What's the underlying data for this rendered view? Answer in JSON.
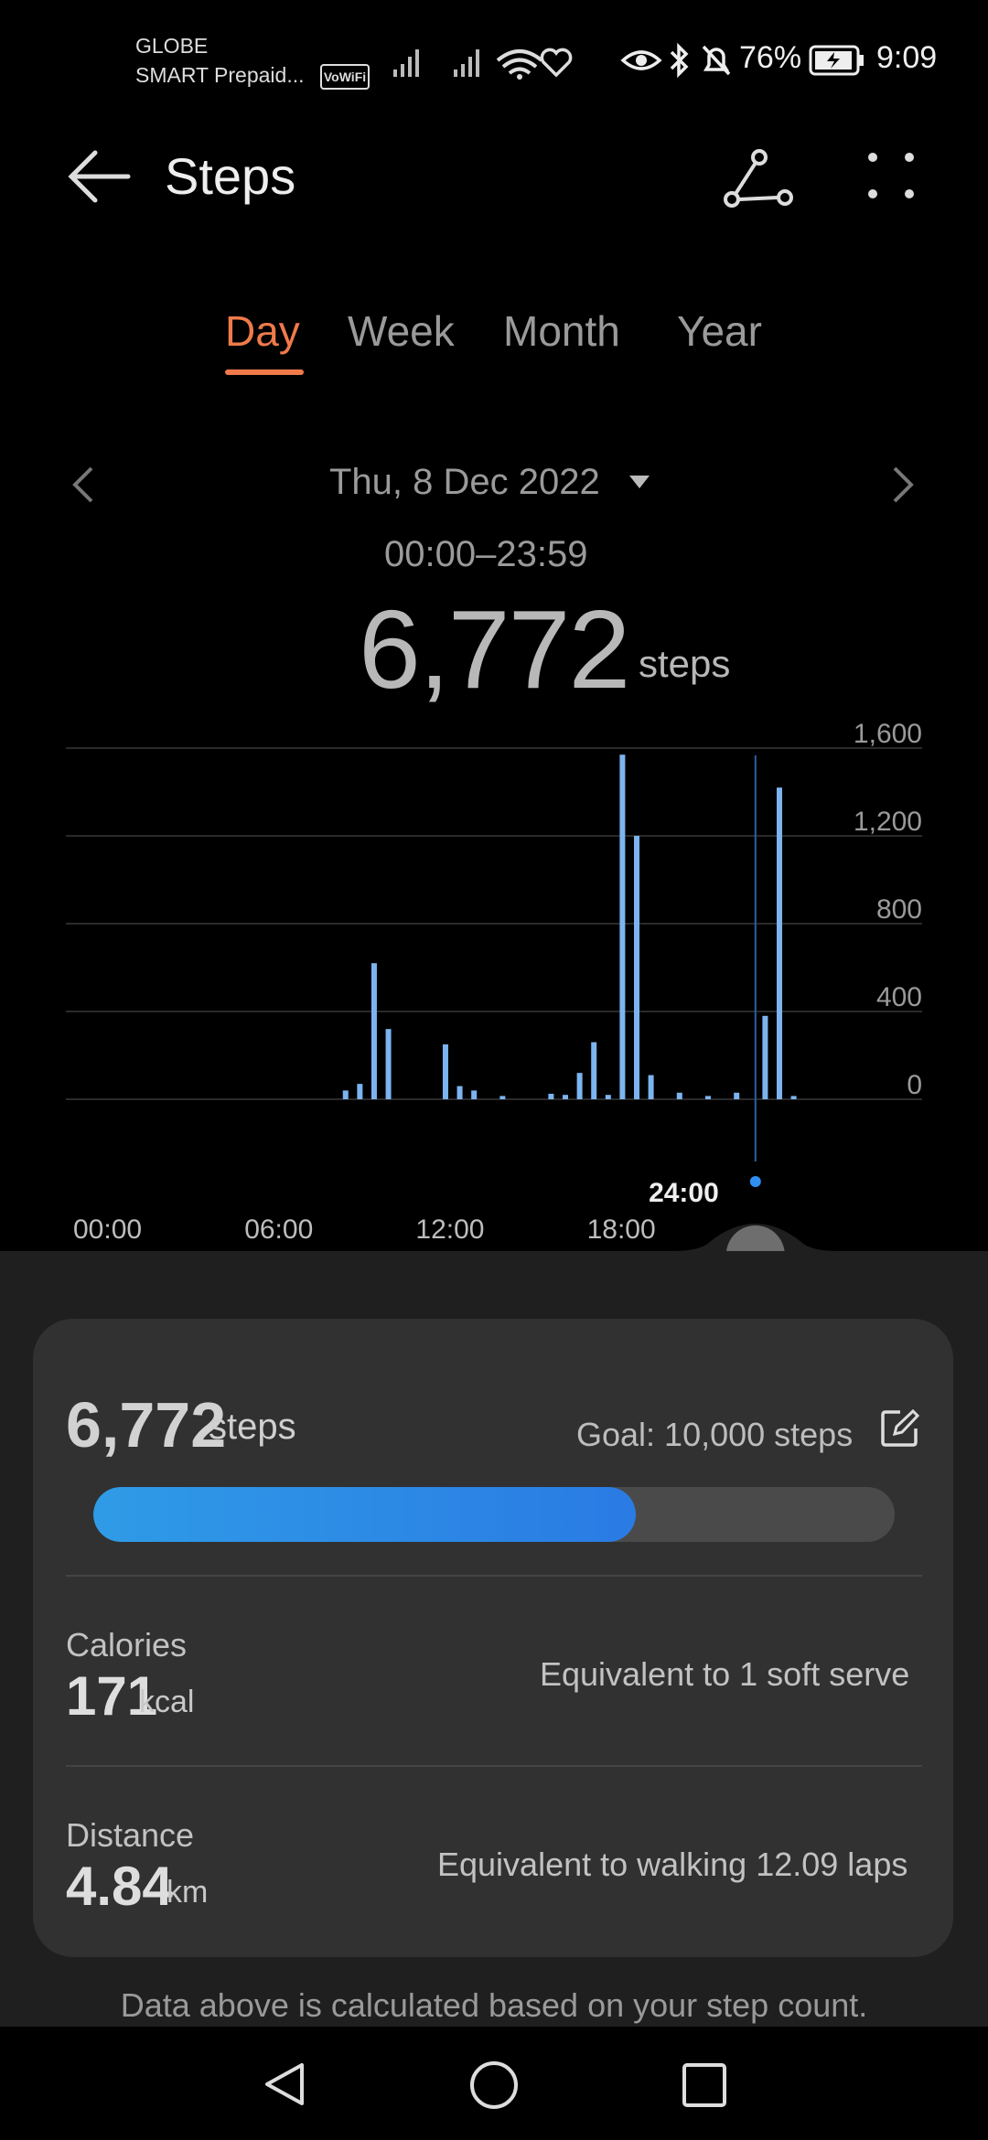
{
  "status_bar": {
    "carrier_line1": "GLOBE",
    "carrier_line2": "SMART Prepaid...",
    "vowifi_label": "VoWiFi",
    "battery_percent": "76%",
    "time": "9:09"
  },
  "header": {
    "title": "Steps",
    "back_icon": "back-arrow-icon",
    "share_icon": "share-route-icon",
    "more_icon": "more-dots-icon"
  },
  "tabs": [
    {
      "label": "Day",
      "active": true
    },
    {
      "label": "Week",
      "active": false
    },
    {
      "label": "Month",
      "active": false
    },
    {
      "label": "Year",
      "active": false
    }
  ],
  "date_nav": {
    "date": "Thu, 8 Dec 2022",
    "range": "00:00–23:59"
  },
  "summary": {
    "steps": "6,772",
    "unit": "steps"
  },
  "chart_data": {
    "type": "bar",
    "y_ticks": [
      "1,600",
      "1,200",
      "800",
      "400",
      "0"
    ],
    "x_ticks": [
      "00:00",
      "06:00",
      "12:00",
      "18:00"
    ],
    "cursor_label": "24:00",
    "ylim": [
      0,
      1600
    ],
    "xlim": [
      0,
      30
    ],
    "bars": [
      {
        "x": 9.8,
        "y": 40
      },
      {
        "x": 10.3,
        "y": 70
      },
      {
        "x": 10.8,
        "y": 620
      },
      {
        "x": 11.3,
        "y": 320
      },
      {
        "x": 13.3,
        "y": 250
      },
      {
        "x": 13.8,
        "y": 60
      },
      {
        "x": 14.3,
        "y": 40
      },
      {
        "x": 15.3,
        "y": 15
      },
      {
        "x": 17.0,
        "y": 25
      },
      {
        "x": 17.5,
        "y": 20
      },
      {
        "x": 18.0,
        "y": 120
      },
      {
        "x": 18.5,
        "y": 260
      },
      {
        "x": 19.0,
        "y": 20
      },
      {
        "x": 19.5,
        "y": 1570
      },
      {
        "x": 20.0,
        "y": 1200
      },
      {
        "x": 20.5,
        "y": 110
      },
      {
        "x": 21.5,
        "y": 30
      },
      {
        "x": 22.5,
        "y": 15
      },
      {
        "x": 23.5,
        "y": 30
      },
      {
        "x": 24.5,
        "y": 380
      },
      {
        "x": 25.0,
        "y": 1420
      },
      {
        "x": 25.5,
        "y": 15
      }
    ]
  },
  "card": {
    "steps": "6,772",
    "steps_unit": "steps",
    "goal": "Goal: 10,000 steps",
    "edit_icon": "edit-icon",
    "progress": 0.6772,
    "calories": {
      "label": "Calories",
      "value": "171",
      "unit": "kcal",
      "equivalent": "Equivalent to 1 soft serve"
    },
    "distance": {
      "label": "Distance",
      "value": "4.84",
      "unit": "km",
      "equivalent": "Equivalent to walking 12.09 laps"
    }
  },
  "footnote": "Data above is calculated based on your step count.",
  "nav_bar": {
    "back_icon": "nav-back-icon",
    "home_icon": "nav-home-icon",
    "recents_icon": "nav-recents-icon"
  }
}
